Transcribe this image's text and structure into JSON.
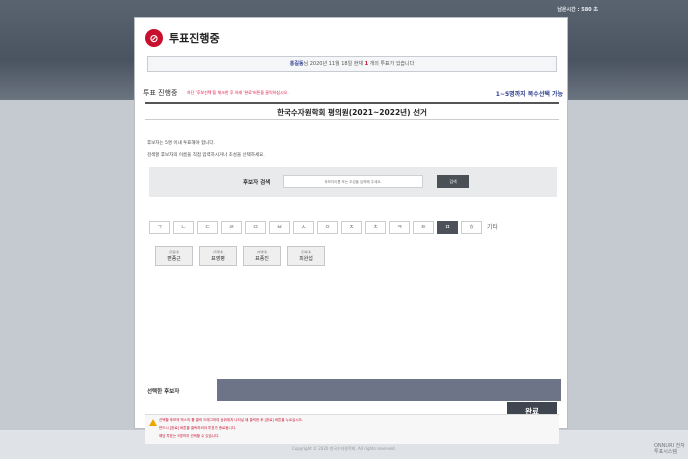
{
  "header": {
    "timer": "남은시간 : 580 초"
  },
  "logo": {
    "text": "투표진행중"
  },
  "notice": {
    "name": "홍길동",
    "text": "님 2020년 11월 18일 현재",
    "count": "1",
    "suffix": "개의 투표가 있습니다"
  },
  "section": {
    "title": "투표 진행중",
    "hint": "하단 '후보선택'을 체크한 후 아래 '완료'버튼을 클릭하십시오.",
    "right": "1~5명까지 복수선택 가능"
  },
  "election": {
    "title": "한국수자원학회 평의원(2021~2022년) 선거"
  },
  "desc": {
    "line1": "후보자는 5명 이내 투표해야 합니다.",
    "line2": "검색할 후보자의 이름을 직접 입력하시거나 초성을 선택하세요."
  },
  "search": {
    "label": "후보자 검색",
    "placeholder": "후보자이름 또는 초성을 입력해 주세요.",
    "button": "검색"
  },
  "consonants": [
    "ㄱ",
    "ㄴ",
    "ㄷ",
    "ㄹ",
    "ㅁ",
    "ㅂ",
    "ㅅ",
    "ㅇ",
    "ㅈ",
    "ㅊ",
    "ㅋ",
    "ㅌ",
    "ㅍ",
    "ㅎ"
  ],
  "active_consonant": 12,
  "consonant_etc": "기타",
  "candidates": [
    {
      "dept": "(한림대)",
      "name": "편종근"
    },
    {
      "dept": "(국제대)",
      "name": "표영평"
    },
    {
      "dept": "(부경대)",
      "name": "표종진"
    },
    {
      "dept": "(전북대)",
      "name": "피완섭"
    }
  ],
  "selected": {
    "label": "선택한 후보자"
  },
  "warnings": [
    "선택할 후보의 박스의 를 클릭 드래그하여 상위위치 나타날 때 클릭한 후 [완료] 버튼을 누르십시오.",
    "반드시 [완료] 버튼을 클릭하셔야 투표가 종료됩니다.",
    "해당 투표는 5명까지 선택할 수 있습니다."
  ],
  "done_button": "완료",
  "footer": {
    "copyright": "Copyright © 2020 한국수자원학회. All rights reserved."
  },
  "corner_logo": "ONNURI 전자투표시스템",
  "colors": {
    "accent": "#2c3e90",
    "brand": "#c8102e",
    "dark_button": "#3f4650",
    "selected_area": "#6e7488"
  }
}
